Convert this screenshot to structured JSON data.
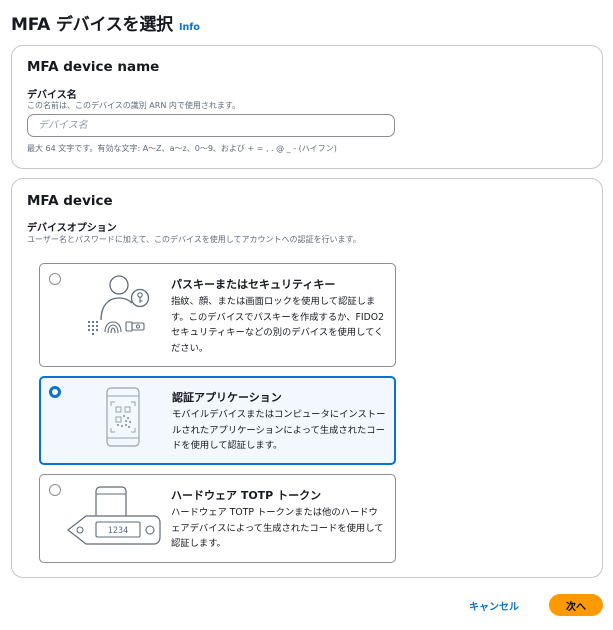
{
  "header": {
    "title": "MFA デバイスを選択",
    "info_label": "Info"
  },
  "device_name_section": {
    "title": "MFA device name",
    "field_label": "デバイス名",
    "field_description": "この名前は、このデバイスの識別 ARN 内で使用されます。",
    "input_value": "",
    "input_placeholder": "デバイス名",
    "constraint_text": "最大 64 文字です。有効な文字: A〜Z、a〜z、0〜9、および + = , . @ _ - (ハイフン)"
  },
  "device_section": {
    "title": "MFA device",
    "field_label": "デバイスオプション",
    "field_description": "ユーザー名とパスワードに加えて、このデバイスを使用してアカウントへの認証を行います。",
    "options": [
      {
        "title": "パスキーまたはセキュリティキー",
        "description": "指紋、顔、または画面ロックを使用して認証します。このデバイスでパスキーを作成するか、FIDO2 セキュリティキーなどの別のデバイスを使用してください。",
        "selected": false,
        "icon": "passkey-illustration"
      },
      {
        "title": "認証アプリケーション",
        "description": "モバイルデバイスまたはコンピュータにインストールされたアプリケーションによって生成されたコードを使用して認証します。",
        "selected": true,
        "icon": "authenticator-app-illustration"
      },
      {
        "title": "ハードウェア TOTP トークン",
        "description": "ハードウェア TOTP トークンまたは他のハードウェアデバイスによって生成されたコードを使用して認証します。",
        "selected": false,
        "icon": "hardware-token-illustration",
        "token_display": "1234"
      }
    ]
  },
  "footer": {
    "cancel_label": "キャンセル",
    "next_label": "次へ"
  },
  "colors": {
    "accent": "#0972d3",
    "primary_button": "#ff9900",
    "selected_bg": "#f2f8fd",
    "border": "#c6c6cd"
  }
}
